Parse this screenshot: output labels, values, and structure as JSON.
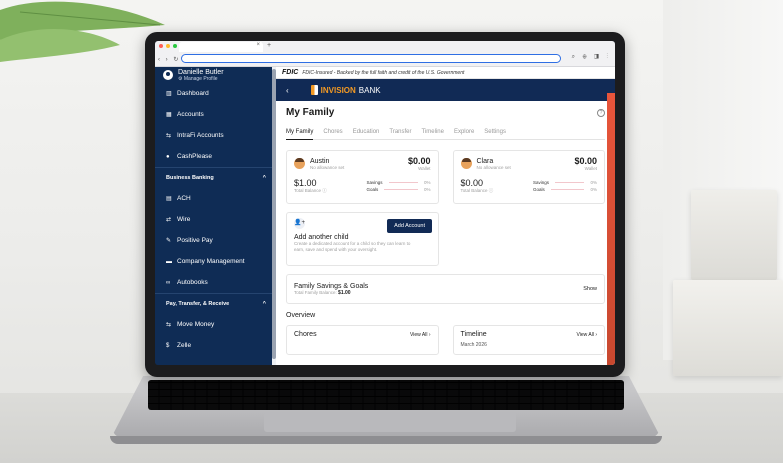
{
  "browser": {
    "new_tab": "+",
    "tab_close": "×",
    "nav_glyphs": "‹ › ↻ ⓘ",
    "right_glyphs": "⌕ ⊕ ◨ ⋮"
  },
  "profile": {
    "name": "Danielle Butler",
    "manage": "⚙ Manage Profile"
  },
  "sidebar": {
    "items": [
      {
        "icon": "▥",
        "label": "Dashboard"
      },
      {
        "icon": "▦",
        "label": "Accounts"
      },
      {
        "icon": "⇆",
        "label": "IntraFi Accounts"
      },
      {
        "icon": "●",
        "label": "CashPlease"
      }
    ],
    "section1": {
      "label": "Business Banking",
      "chevron": "^"
    },
    "business_items": [
      {
        "icon": "▤",
        "label": "ACH"
      },
      {
        "icon": "⇄",
        "label": "Wire"
      },
      {
        "icon": "✎",
        "label": "Positive Pay"
      },
      {
        "icon": "▬",
        "label": "Company Management"
      },
      {
        "icon": "∞",
        "label": "Autobooks"
      }
    ],
    "section2": {
      "label": "Pay, Transfer, & Receive",
      "chevron": "^"
    },
    "pay_items": [
      {
        "icon": "⇆",
        "label": "Move Money"
      },
      {
        "icon": "$",
        "label": "Zelle"
      }
    ]
  },
  "fdic": {
    "logo": "FDIC",
    "text": "FDIC-Insured - Backed by the full faith and credit of the U.S. Government"
  },
  "brand": {
    "back": "‹",
    "name_bold": "INVISION",
    "name_light": "BANK"
  },
  "page": {
    "title": "My Family",
    "help": "?",
    "tabs": [
      "My Family",
      "Chores",
      "Education",
      "Transfer",
      "Timeline",
      "Explore",
      "Settings"
    ]
  },
  "children": [
    {
      "name": "Austin",
      "allowance": "No allowance set",
      "wallet": "$0.00",
      "wallet_label": "Wallet",
      "balance": "$1.00",
      "balance_label": "Total Balance ⓘ",
      "savings_label": "Savings",
      "savings_pct": "0%",
      "goals_label": "Goals",
      "goals_pct": "0%"
    },
    {
      "name": "Clara",
      "allowance": "No allowance set",
      "wallet": "$0.00",
      "wallet_label": "Wallet",
      "balance": "$0.00",
      "balance_label": "Total Balance ⓘ",
      "savings_label": "Savings",
      "savings_pct": "0%",
      "goals_label": "Goals",
      "goals_pct": "0%"
    }
  ],
  "add_child": {
    "icon": "👤+",
    "button": "Add Account",
    "title": "Add another child",
    "description": "Create a dedicated account for a child so they can learn to earn, save and spend with your oversight."
  },
  "family_savings": {
    "title": "Family Savings & Goals",
    "sub": "Total Family Balance:",
    "amount": "$1.00",
    "show": "Show"
  },
  "overview": {
    "heading": "Overview",
    "chores": {
      "title": "Chores",
      "link": "View All ›"
    },
    "timeline": {
      "title": "Timeline",
      "link": "View All ›",
      "sub": "March 2026"
    }
  }
}
